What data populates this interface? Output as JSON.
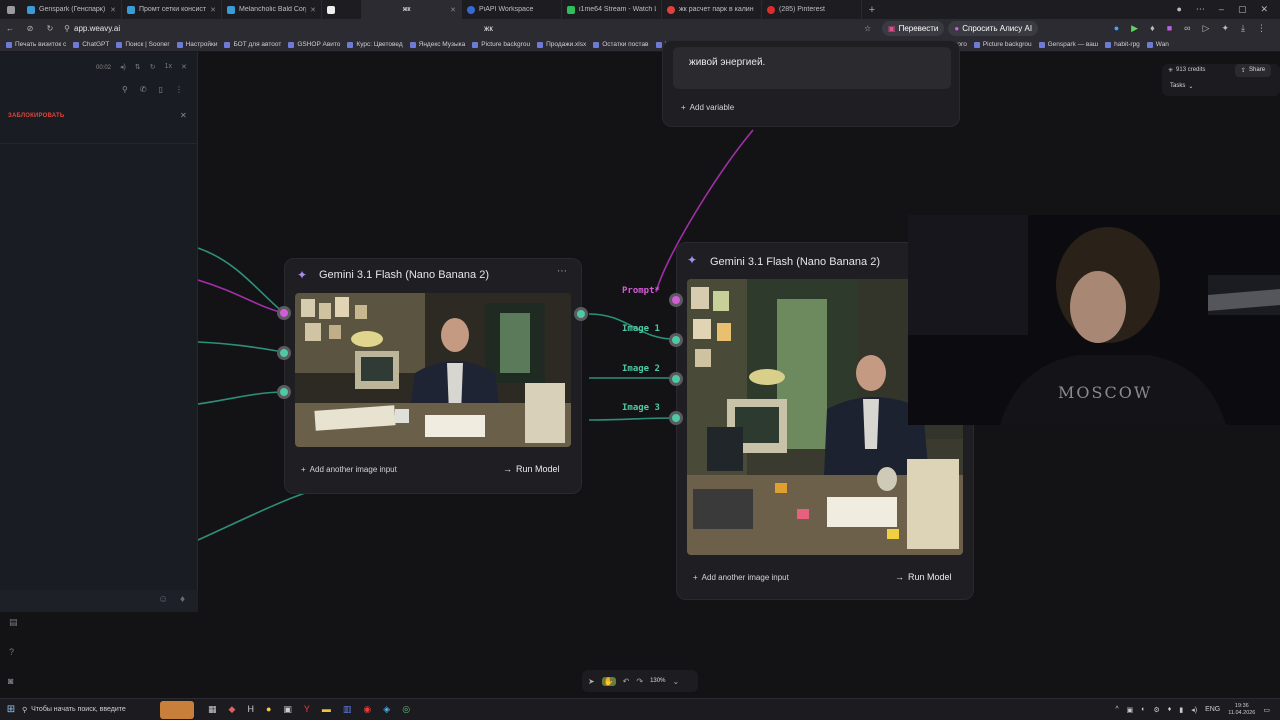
{
  "browser": {
    "tabs": [
      {
        "label": "Genspark (Генспарк) — в"
      },
      {
        "label": "Промт сетки консистент"
      },
      {
        "label": "Melancholic Bald Corpora"
      },
      {
        "label": ""
      },
      {
        "label": "жк"
      },
      {
        "label": "PiAPI Workspace"
      },
      {
        "label": "i1me64 Stream - Watch Li"
      },
      {
        "label": "жк расчет парк в калин"
      },
      {
        "label": "(285) Pinterest"
      }
    ],
    "url": "app.weavy.ai",
    "page_title": "жк",
    "translate_label": "Перевести",
    "alice_label": "Спросить Алису AI",
    "bookmarks": [
      "Печать визиток с",
      "ChatGPT",
      "Поиск | Sooner",
      "Настройки",
      "БОТ для автоот",
      "GSHOP Авито",
      "Курс: Цветовед",
      "Яндекс Музыка",
      "Picture backgrou",
      "Продажи.xlsx",
      "Остатки постав",
      "YARN Story: unc",
      "Word | Microsoft",
      "Picture backgrou",
      "Picture backgrou",
      "Бутик Русского",
      "Picture backgrou",
      "Genspark — ваш",
      "habit-rpg",
      "Wan"
    ]
  },
  "left_panel": {
    "timer": "00:02",
    "block_label": "ЗАБЛОКИРОВАТЬ"
  },
  "top_right": {
    "credits": "913 credits",
    "share_label": "Share",
    "tasks_label": "Tasks"
  },
  "prompt_node": {
    "text_tail": "живой энергией.",
    "add_variable_label": "Add variable"
  },
  "node1": {
    "title": "Gemini 3.1 Flash (Nano Banana 2)",
    "menu_icon": "more-icon",
    "add_input_label": "Add another image input",
    "run_label": "Run Model"
  },
  "node2": {
    "title": "Gemini 3.1 Flash (Nano Banana 2)",
    "add_input_label": "Add another image input",
    "run_label": "Run Model",
    "inputs": [
      {
        "label": "Prompt*",
        "color": "#d35dd6"
      },
      {
        "label": "Image 1",
        "color": "#4fc9a2"
      },
      {
        "label": "Image 2",
        "color": "#4fc9a2"
      },
      {
        "label": "Image 3",
        "color": "#4fc9a2"
      }
    ]
  },
  "webcam": {
    "shirt_text": "MOSCOW"
  },
  "toolbar": {
    "zoom": "130%"
  },
  "taskbar": {
    "search_placeholder": "Чтобы начать поиск, введите",
    "lang": "ENG",
    "time": "19:36",
    "date": "11.04.2026"
  },
  "colors": {
    "accent_pink": "#d35dd6",
    "accent_green": "#4fc9a2",
    "canvas_bg": "#131316"
  }
}
